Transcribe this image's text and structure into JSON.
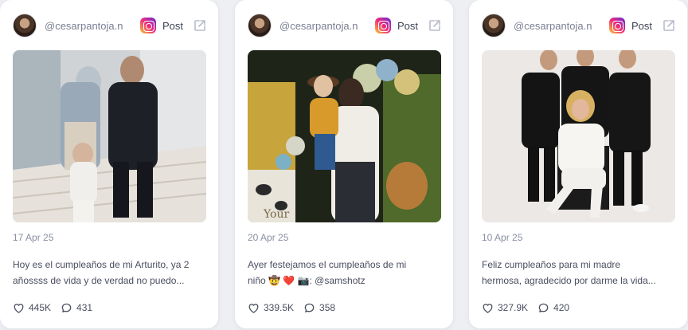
{
  "posts": [
    {
      "handle": "@cesarpantoja.n",
      "platform_label": "Post",
      "date": "17 Apr 25",
      "caption_line1": "Hoy es el cumpleaños de mi Arturito, ya 2",
      "caption_line2": "añossss de vida y de verdad no puedo...",
      "likes": "445K",
      "comments": "431"
    },
    {
      "handle": "@cesarpantoja.n",
      "platform_label": "Post",
      "date": "20 Apr 25",
      "caption_line1": "Ayer festejamos el cumpleaños de mi",
      "caption_line2": "niño 🤠 ❤️ 📷: @samshotz",
      "likes": "339.5K",
      "comments": "358"
    },
    {
      "handle": "@cesarpantoja.n",
      "platform_label": "Post",
      "date": "10 Apr 25",
      "caption_line1": "Feliz cumpleaños para mi madre",
      "caption_line2": "hermosa, agradecido por darme la vida...",
      "likes": "327.9K",
      "comments": "420"
    }
  ],
  "icons": {
    "platform": "instagram-icon",
    "external": "external-link-icon",
    "likes": "heart-icon",
    "comments": "comment-icon"
  },
  "colors": {
    "background": "#eeeff3",
    "card": "#ffffff",
    "muted_text": "#8a8fa3",
    "body_text": "#4a4e60"
  }
}
